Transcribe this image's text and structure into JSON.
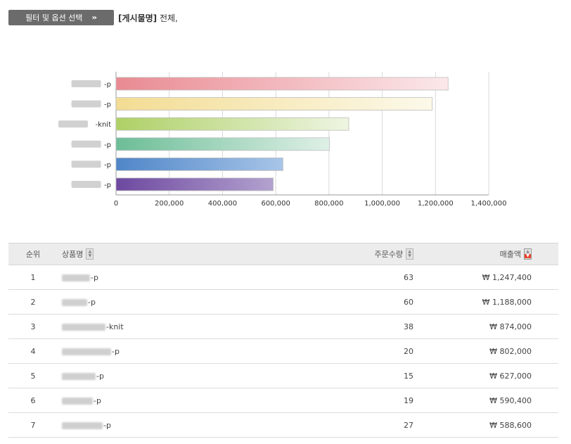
{
  "toolbar": {
    "filter_label": "필터 및 옵션 선택",
    "filter_chevron": "»",
    "scope_label": "[게시물명]",
    "scope_value": "전체,"
  },
  "colors": {
    "bars": [
      [
        "#e98a92",
        "#fbe8ea"
      ],
      [
        "#f3dc93",
        "#fcf9ea"
      ],
      [
        "#aed066",
        "#eef5e2"
      ],
      [
        "#6cbd97",
        "#dff0e7"
      ],
      [
        "#4f86c8",
        "#a8c5e8"
      ],
      [
        "#6d48a0",
        "#b3a2cf"
      ]
    ]
  },
  "chart_data": {
    "type": "bar",
    "orientation": "horizontal",
    "categories": [
      "-p",
      "-p",
      "-knit",
      "-p",
      "-p",
      "-p"
    ],
    "values": [
      1247400,
      1188000,
      874000,
      802000,
      627000,
      590400
    ],
    "xlim": [
      0,
      1400000
    ],
    "x_ticks": [
      "0",
      "200,000",
      "400,000",
      "600,000",
      "800,000",
      "1,000,000",
      "1,200,000",
      "1,400,000"
    ],
    "grid": true
  },
  "table": {
    "headers": {
      "rank": "순위",
      "name": "상품명",
      "qty": "주문수량",
      "sales": "매출액"
    },
    "rows": [
      {
        "rank": "1",
        "name_suffix": "-p",
        "qty": "63",
        "sales": "₩ 1,247,400"
      },
      {
        "rank": "2",
        "name_suffix": "-p",
        "qty": "60",
        "sales": "₩ 1,188,000"
      },
      {
        "rank": "3",
        "name_suffix": "-knit",
        "qty": "38",
        "sales": "₩ 874,000"
      },
      {
        "rank": "4",
        "name_suffix": "-p",
        "qty": "20",
        "sales": "₩ 802,000"
      },
      {
        "rank": "5",
        "name_suffix": "-p",
        "qty": "15",
        "sales": "₩ 627,000"
      },
      {
        "rank": "6",
        "name_suffix": "-p",
        "qty": "19",
        "sales": "₩ 590,400"
      },
      {
        "rank": "7",
        "name_suffix": "-p",
        "qty": "27",
        "sales": "₩ 588,600"
      }
    ]
  }
}
